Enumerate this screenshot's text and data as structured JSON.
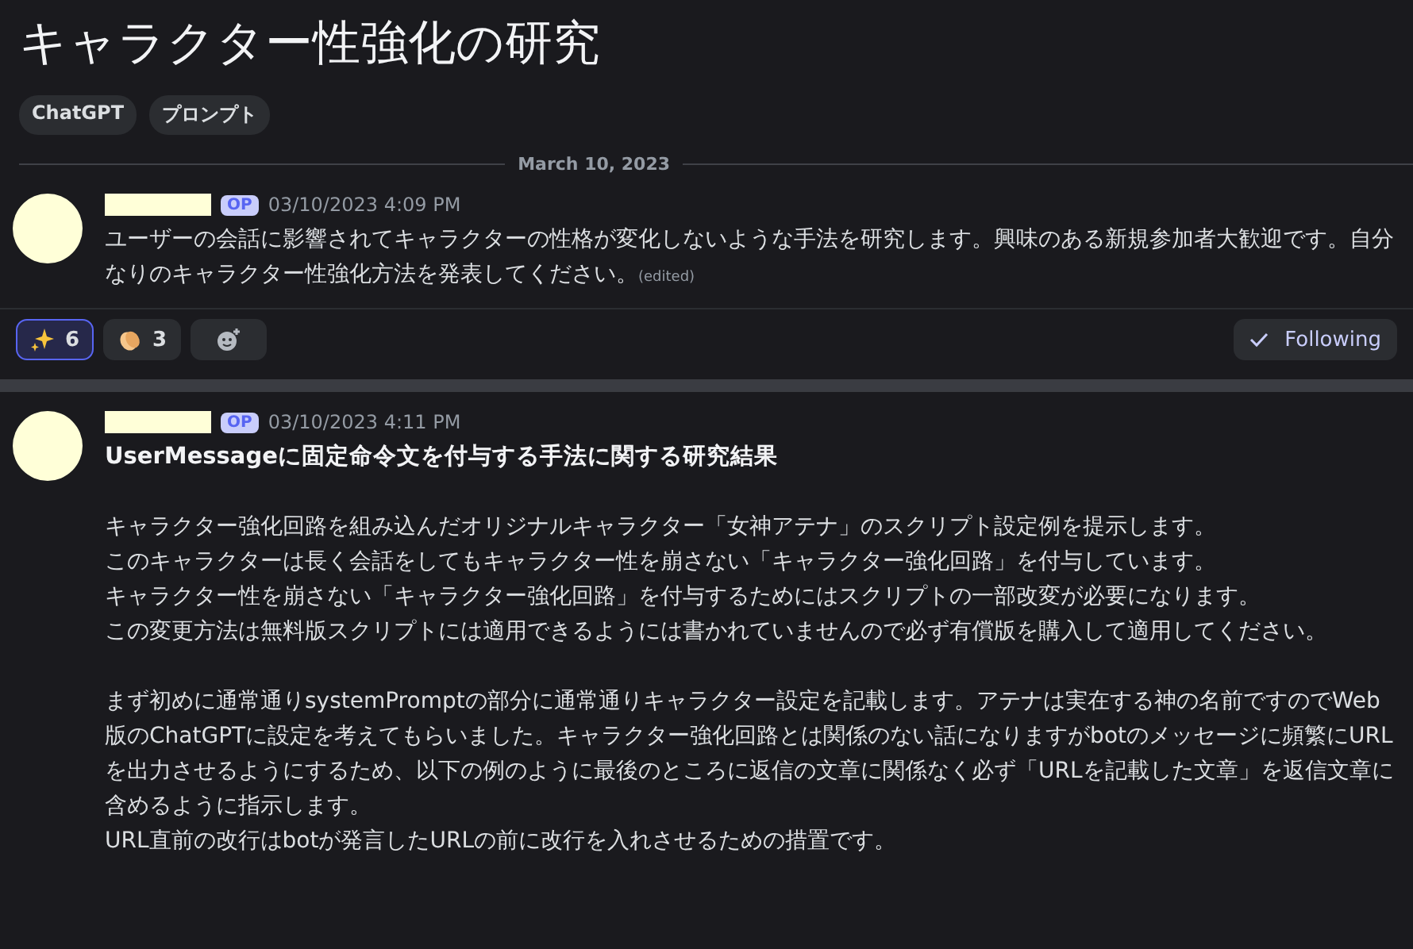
{
  "title": "キャラクター性強化の研究",
  "tags": [
    "ChatGPT",
    "プロンプト"
  ],
  "date_divider": "March 10, 2023",
  "posts": [
    {
      "badge": "OP",
      "timestamp": "03/10/2023 4:09 PM",
      "paragraphs": [
        [
          "ユーザーの会話に影響されてキャラクターの性格が変化しないような手法を研究します。興味のある新規参加者大歓迎です。自分なりのキャラクター性強化方法を発表してください。"
        ]
      ],
      "edited": "(edited)",
      "reactions": [
        {
          "kind": "sparkles",
          "count": "6",
          "selected": true
        },
        {
          "kind": "clap",
          "count": "3",
          "selected": false
        }
      ],
      "follow": {
        "label": "Following",
        "on": true
      }
    },
    {
      "badge": "OP",
      "timestamp": "03/10/2023 4:11 PM",
      "heading": "UserMessageに固定命令文を付与する手法に関する研究結果",
      "paragraphs": [
        [
          "キャラクター強化回路を組み込んだオリジナルキャラクター「女神アテナ」のスクリプト設定例を提示します。",
          "このキャラクターは長く会話をしてもキャラクター性を崩さない「キャラクター強化回路」を付与しています。",
          "キャラクター性を崩さない「キャラクター強化回路」を付与するためにはスクリプトの一部改変が必要になります。",
          "この変更方法は無料版スクリプトには適用できるようには書かれていませんので必ず有償版を購入して適用してください。"
        ],
        [
          "まず初めに通常通りsystemPromptの部分に通常通りキャラクター設定を記載します。アテナは実在する神の名前ですのでWeb版のChatGPTに設定を考えてもらいました。キャラクター強化回路とは関係のない話になりますがbotのメッセージに頻繁にURLを出力させるようにするため、以下の例のように最後のところに返信の文章に関係なく必ず「URLを記載した文章」を返信文章に含めるように指示します。",
          "URL直前の改行はbotが発言したURLの前に改行を入れさせるための措置です。"
        ]
      ]
    }
  ]
}
